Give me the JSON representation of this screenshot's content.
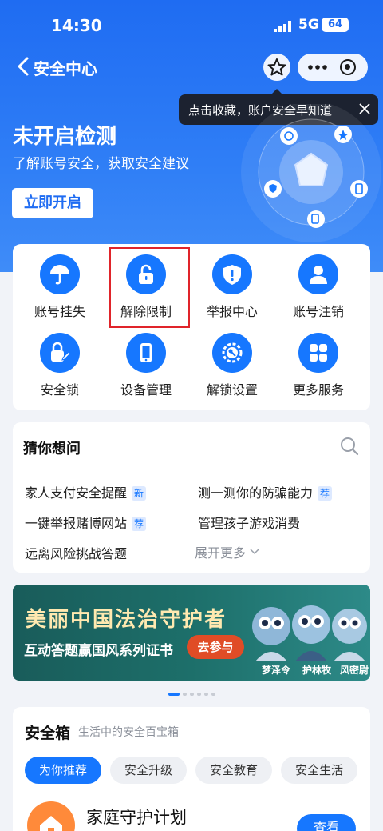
{
  "status_bar": {
    "time": "14:30",
    "network": "5G",
    "battery": "64"
  },
  "nav": {
    "title": "安全中心"
  },
  "tooltip": {
    "text": "点击收藏，账户安全早知道"
  },
  "hero": {
    "title": "未开启检测",
    "subtitle": "了解账号安全，获取安全建议",
    "button": "立即开启"
  },
  "services": [
    {
      "label": "账号挂失",
      "icon": "umbrella-icon"
    },
    {
      "label": "解除限制",
      "icon": "unlock-icon"
    },
    {
      "label": "举报中心",
      "icon": "shield-alert-icon"
    },
    {
      "label": "账号注销",
      "icon": "user-icon"
    },
    {
      "label": "安全锁",
      "icon": "lock-edit-icon"
    },
    {
      "label": "设备管理",
      "icon": "phone-icon"
    },
    {
      "label": "解锁设置",
      "icon": "key-gear-icon"
    },
    {
      "label": "更多服务",
      "icon": "grid-icon"
    }
  ],
  "guess": {
    "title": "猜你想问",
    "questions": [
      {
        "text": "家人支付安全提醒",
        "tag": "新"
      },
      {
        "text": "测一测你的防骗能力",
        "tag": "荐"
      },
      {
        "text": "一键举报赌博网站",
        "tag": "荐"
      },
      {
        "text": "管理孩子游戏消费",
        "tag": ""
      },
      {
        "text": "远离风险挑战答题",
        "tag": ""
      }
    ],
    "expand": "展开更多"
  },
  "banner": {
    "title": "美丽中国法治守护者",
    "subtitle": "互动答题赢国风系列证书",
    "button": "去参与",
    "characters": [
      "梦泽令",
      "护林牧",
      "风密尉"
    ]
  },
  "carousel": {
    "count": 6,
    "active": 0
  },
  "safety_box": {
    "title": "安全箱",
    "subtitle": "生活中的安全百宝箱",
    "tabs": [
      "为你推荐",
      "安全升级",
      "安全教育",
      "安全生活"
    ],
    "active_tab": 0,
    "item_title": "家庭守护计划",
    "item_button": "查看"
  },
  "colors": {
    "primary": "#1677ff",
    "hero_bg": "#2f7ef6",
    "highlight": "#e0242a"
  }
}
